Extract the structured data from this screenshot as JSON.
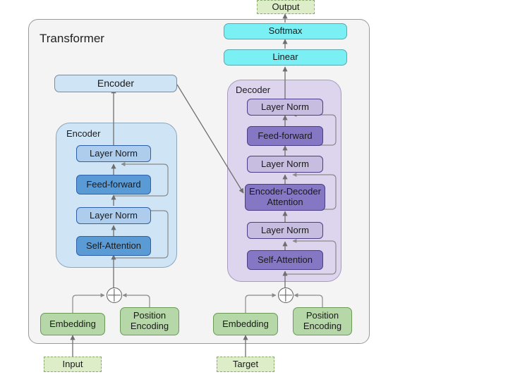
{
  "diagram": {
    "title": "Transformer",
    "io": {
      "output": "Output",
      "input": "Input",
      "target": "Target"
    },
    "head": {
      "softmax": "Softmax",
      "linear": "Linear"
    },
    "encoder_summary": "Encoder",
    "encoder_group": {
      "label": "Encoder",
      "blocks": [
        {
          "label": "Layer Norm",
          "kind": "norm"
        },
        {
          "label": "Feed-forward",
          "kind": "op"
        },
        {
          "label": "Layer Norm",
          "kind": "norm"
        },
        {
          "label": "Self-Attention",
          "kind": "op"
        }
      ]
    },
    "decoder_group": {
      "label": "Decoder",
      "blocks": [
        {
          "label": "Layer Norm",
          "kind": "norm"
        },
        {
          "label": "Feed-forward",
          "kind": "op"
        },
        {
          "label": "Layer Norm",
          "kind": "norm"
        },
        {
          "label": "Encoder-Decoder\nAttention",
          "kind": "op"
        },
        {
          "label": "Layer Norm",
          "kind": "norm"
        },
        {
          "label": "Self-Attention",
          "kind": "op"
        }
      ]
    },
    "source_inputs": {
      "embedding": "Embedding",
      "position_encoding": "Position\nEncoding"
    },
    "target_inputs": {
      "embedding": "Embedding",
      "position_encoding": "Position\nEncoding"
    },
    "add_symbol": "⊕",
    "colors": {
      "frame_bg": "#f4f4f4",
      "frame_border": "#9a9a9a",
      "encoder_group_bg": "#cfe4f5",
      "decoder_group_bg": "#ddd5ee",
      "encoder_norm": "#aecdec",
      "encoder_op": "#5b9bd5",
      "decoder_norm": "#c6bde0",
      "decoder_op": "#8577c4",
      "head_block": "#7bf0f4",
      "embedding_block": "#b6d7a8",
      "io_block": "#dcedc8",
      "arrow": "#6e6e6e"
    }
  }
}
